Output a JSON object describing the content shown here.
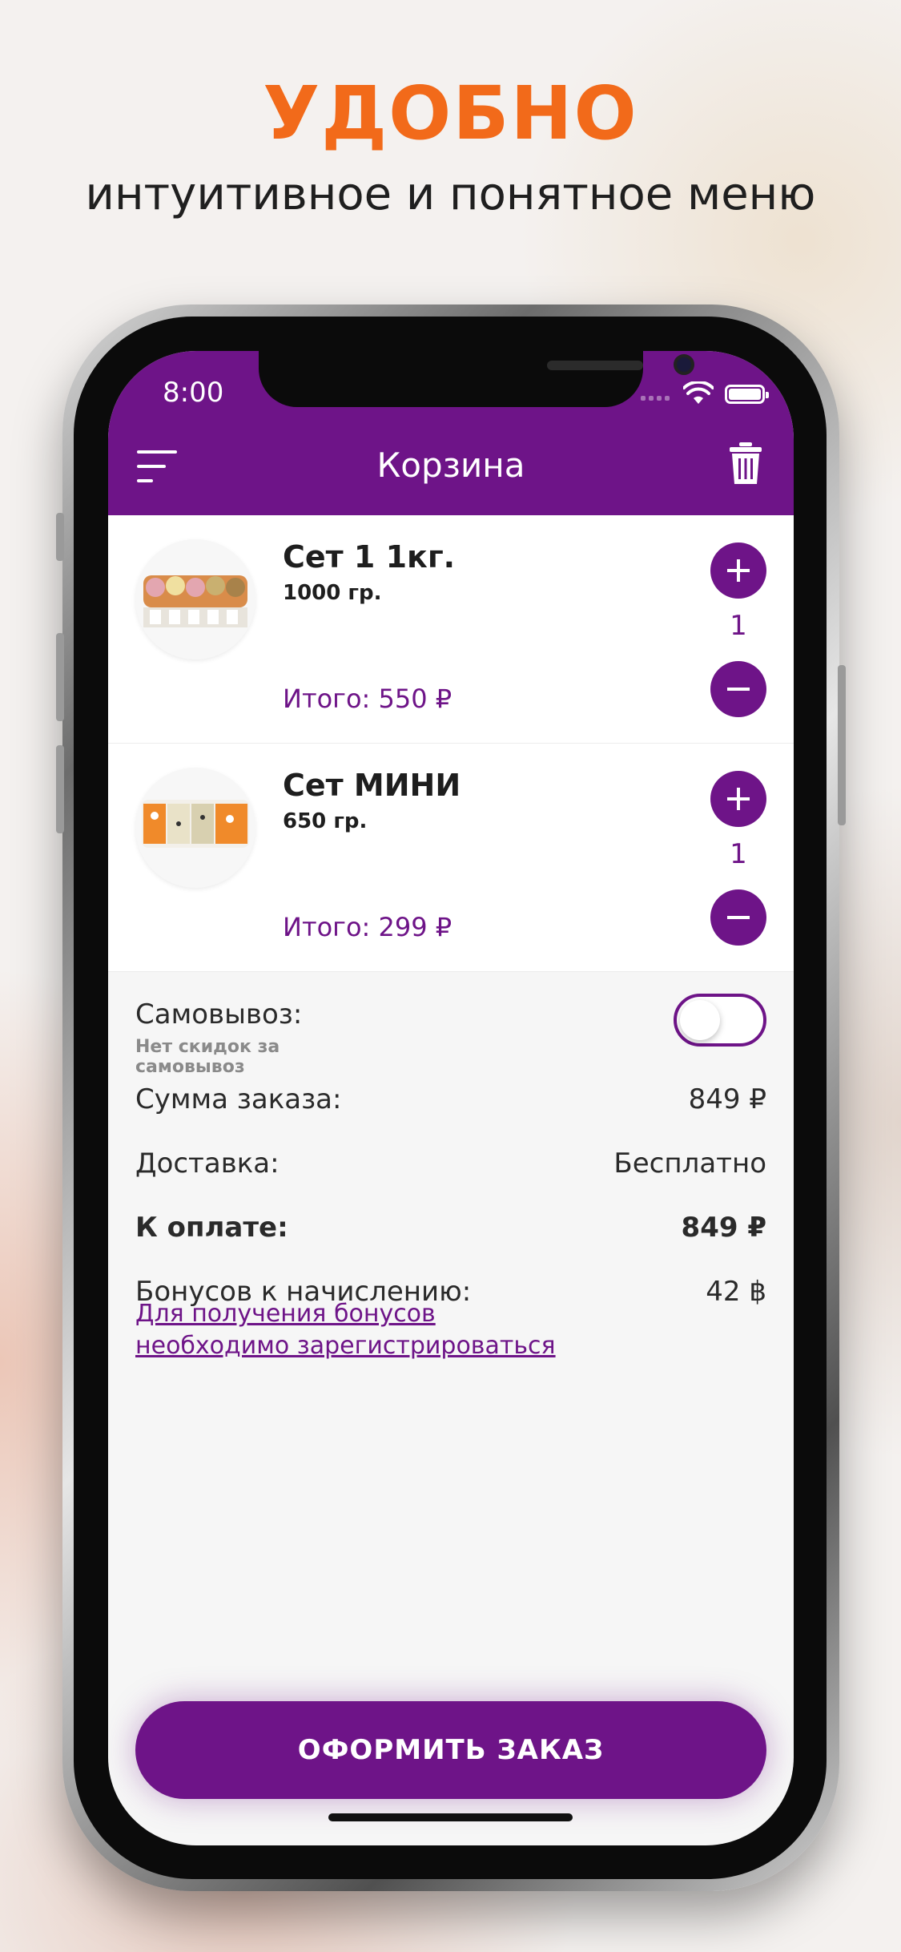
{
  "promo": {
    "headline": "УДОБНО",
    "subline": "интуитивное и понятное меню"
  },
  "status_bar": {
    "time": "8:00"
  },
  "header": {
    "title": "Корзина",
    "menu_icon": "hamburger-menu-icon",
    "trash_icon": "trash-icon"
  },
  "colors": {
    "brand": "#6e1488",
    "accent": "#f26a1a"
  },
  "cart": {
    "items": [
      {
        "name": "Сет  1 1кг.",
        "weight": "1000 гр.",
        "total": "Итого: 550 ₽",
        "qty": "1"
      },
      {
        "name": "Сет МИНИ",
        "weight": "650 гр.",
        "total": "Итого: 299 ₽",
        "qty": "1"
      }
    ]
  },
  "summary": {
    "pickup_label": "Самовывоз:",
    "pickup_note": "Нет скидок за самовывоз",
    "pickup_enabled": false,
    "order_sum_label": "Сумма заказа:",
    "order_sum_value": "849 ₽",
    "delivery_label": "Доставка:",
    "delivery_value": "Бесплатно",
    "to_pay_label": "К оплате:",
    "to_pay_value": "849 ₽",
    "bonus_label": "Бонусов к начислению:",
    "bonus_value": "42 ฿",
    "bonus_link": "Для получения бонусов необходимо зарегистрироваться"
  },
  "checkout_button": "ОФОРМИТЬ ЗАКАЗ"
}
